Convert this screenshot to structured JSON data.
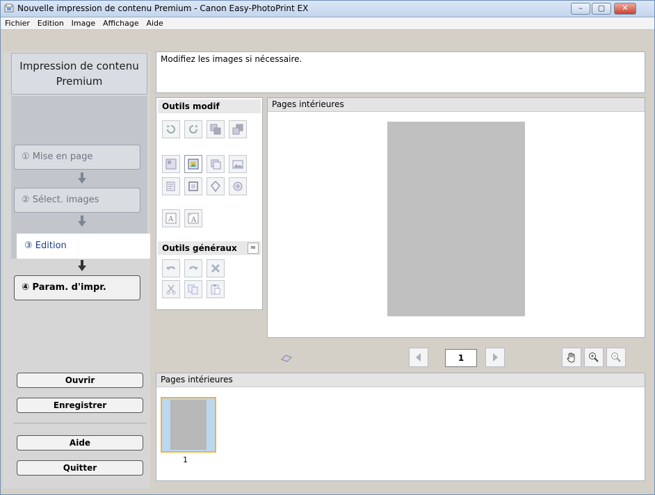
{
  "window": {
    "title": "Nouvelle impression de contenu Premium - Canon Easy-PhotoPrint EX",
    "controls": {
      "minimize": "–",
      "maximize": "▢",
      "close": "✕"
    }
  },
  "menu": [
    "Fichier",
    "Edition",
    "Image",
    "Affichage",
    "Aide"
  ],
  "sidebar": {
    "title": "Impression de contenu Premium",
    "steps": [
      {
        "label": "① Mise en page"
      },
      {
        "label": "② Sélect. images"
      },
      {
        "label": "③ Edition"
      },
      {
        "label": "④ Param. d'impr."
      }
    ],
    "buttons": {
      "open": "Ouvrir",
      "save": "Enregistrer",
      "help": "Aide",
      "quit": "Quitter"
    }
  },
  "message": "Modifiez les images si nécessaire.",
  "tools": {
    "edit_header": "Outils modif",
    "general_header": "Outils généraux",
    "collapse_symbol": "≈"
  },
  "preview": {
    "header": "Pages intérieures",
    "page_number": "1"
  },
  "thumbnails": {
    "header": "Pages intérieures",
    "items": [
      {
        "label": "1"
      }
    ]
  },
  "colors": {
    "accent": "#1d3f8a",
    "thumbnail_selected_border": "#f2b33a",
    "page_placeholder": "#c0c0c0"
  }
}
